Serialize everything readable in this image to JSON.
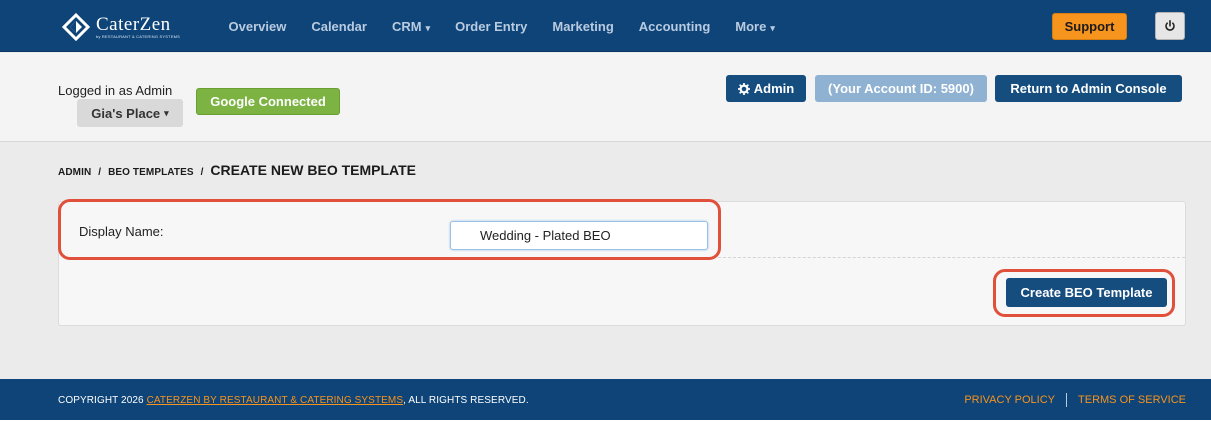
{
  "brand": {
    "name": "CaterZen",
    "tagline": "by RESTAURANT & CATERING SYSTEMS"
  },
  "nav": {
    "items": [
      {
        "label": "Overview"
      },
      {
        "label": "Calendar"
      },
      {
        "label": "CRM",
        "caret": "▾"
      },
      {
        "label": "Order Entry"
      },
      {
        "label": "Marketing"
      },
      {
        "label": "Accounting"
      },
      {
        "label": "More",
        "caret": "▾"
      }
    ],
    "support_label": "Support",
    "power_icon": "power-icon"
  },
  "account": {
    "logged_in_text": "Logged in as Admin",
    "place_label": "Gia's Place",
    "place_caret": "▾",
    "google_status": "Google Connected",
    "admin_label": "Admin",
    "admin_icon": "gear-icon",
    "account_id_text": "(Your Account ID: 5900)",
    "return_label": "Return to Admin Console"
  },
  "breadcrumb": {
    "items": [
      "ADMIN",
      "BEO TEMPLATES"
    ],
    "separator": "/",
    "current": "CREATE NEW BEO TEMPLATE"
  },
  "form": {
    "display_name_label": "Display Name:",
    "display_name_value": "Wedding - Plated BEO",
    "create_button_label": "Create BEO Template"
  },
  "footer": {
    "copyright_prefix": "COPYRIGHT 2026 ",
    "copyright_link": "CATERZEN BY RESTAURANT & CATERING SYSTEMS",
    "copyright_suffix": ", ALL RIGHTS RESERVED.",
    "privacy_label": "PRIVACY POLICY",
    "terms_label": "TERMS OF SERVICE"
  },
  "colors": {
    "nav_bg": "#0e4478",
    "primary_button": "#154d7f",
    "accent_orange": "#f7941d",
    "google_green": "#7cb342",
    "highlight_red": "#e0503a"
  }
}
